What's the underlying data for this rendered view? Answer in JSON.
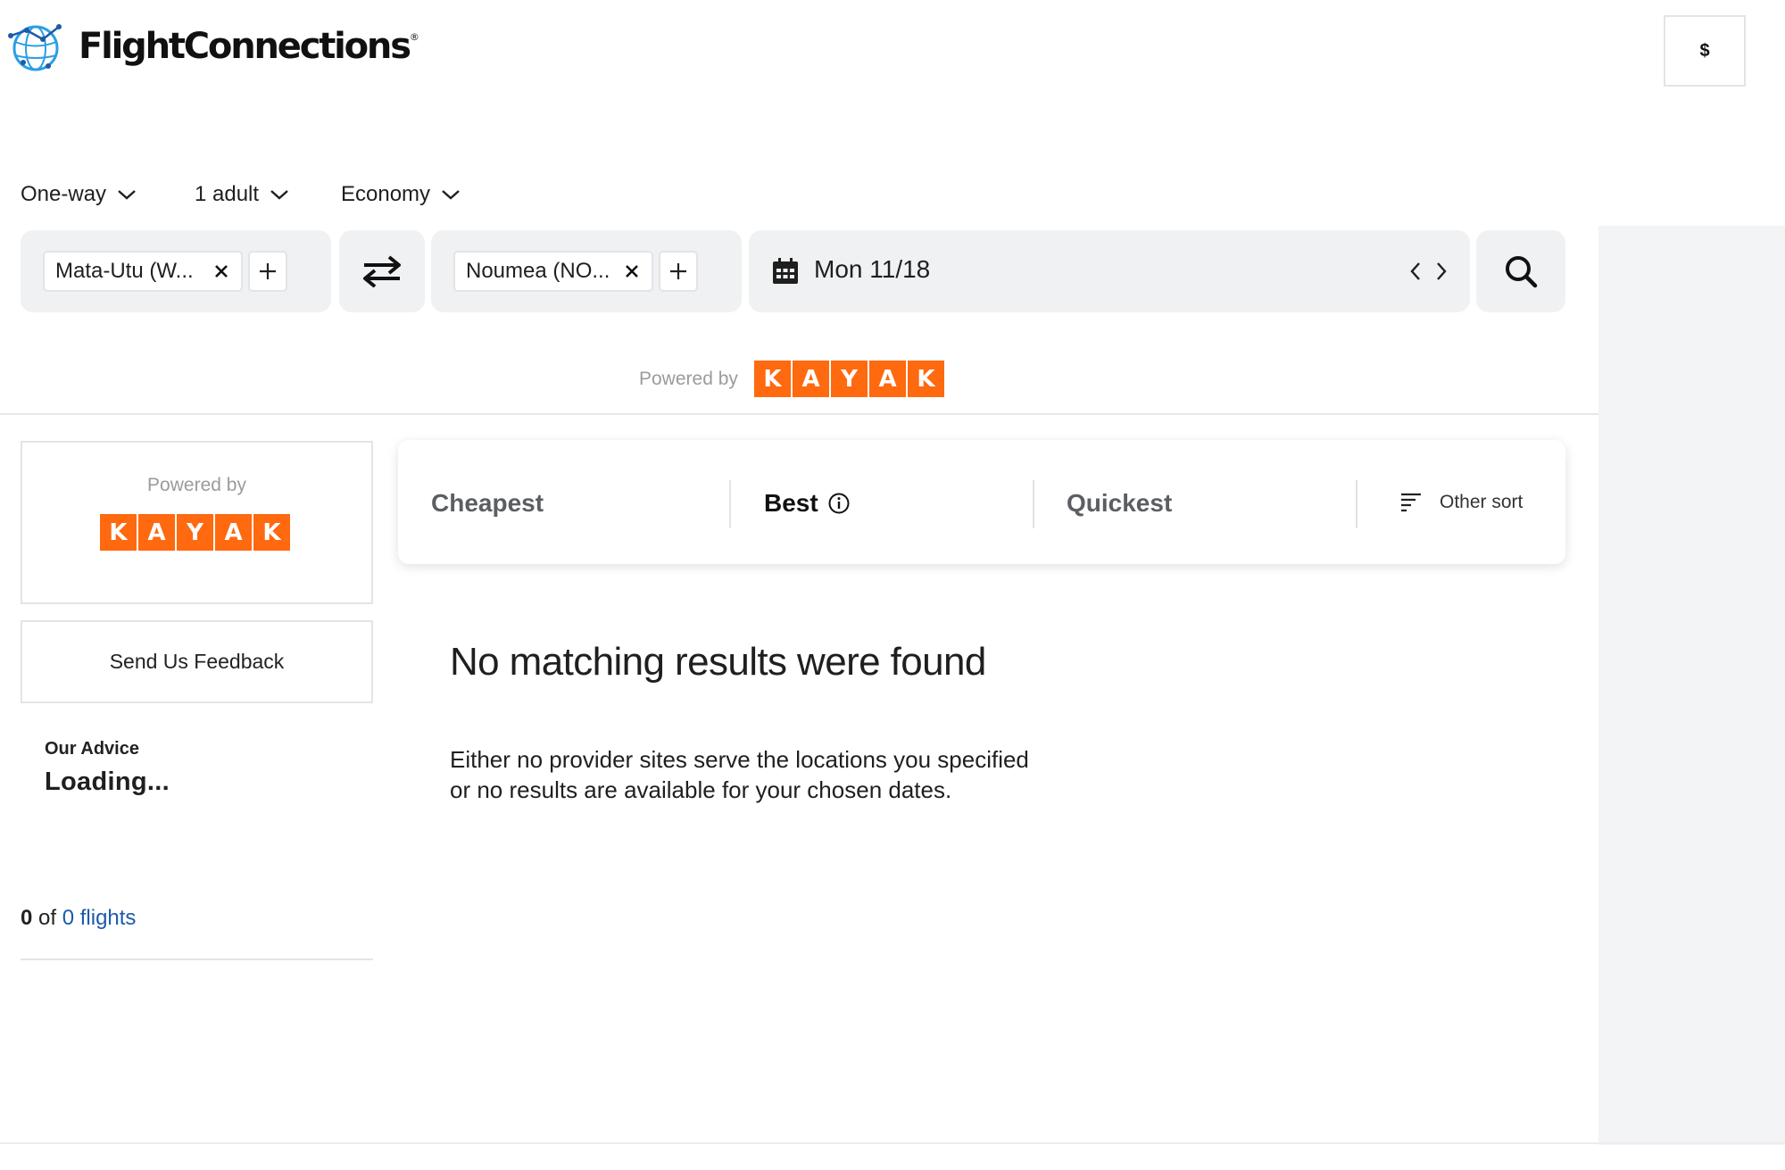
{
  "header": {
    "brand": "FlightConnections",
    "registered_mark": "®",
    "currency_symbol": "$"
  },
  "trip_options": {
    "trip_type": "One-way",
    "passengers": "1 adult",
    "cabin": "Economy"
  },
  "search": {
    "origin": "Mata-Utu (W...",
    "destination": "Noumea (NO...",
    "date": "Mon 11/18"
  },
  "powered": {
    "label": "Powered by",
    "letters": [
      "K",
      "A",
      "Y",
      "A",
      "K"
    ]
  },
  "colors": {
    "kayak_orange": "#ff690f",
    "link_blue": "#1d5aa8",
    "logo_blue": "#2a9ee4"
  },
  "sidebar": {
    "feedback_label": "Send Us Feedback",
    "advice_title": "Our Advice",
    "advice_value": "Loading...",
    "count_shown": "0",
    "count_of": "of",
    "count_total": "0 flights"
  },
  "sort": {
    "cheapest": "Cheapest",
    "best": "Best",
    "quickest": "Quickest",
    "other": "Other sort"
  },
  "results": {
    "title": "No matching results were found",
    "line1": "Either no provider sites serve the locations you specified",
    "line2": "or no results are available for your chosen dates."
  },
  "icons": [
    "globe-logo-icon",
    "chevron-down-icon",
    "close-icon",
    "plus-icon",
    "swap-icon",
    "calendar-icon",
    "chevron-left-icon",
    "chevron-right-icon",
    "search-icon",
    "info-icon",
    "sort-icon"
  ]
}
